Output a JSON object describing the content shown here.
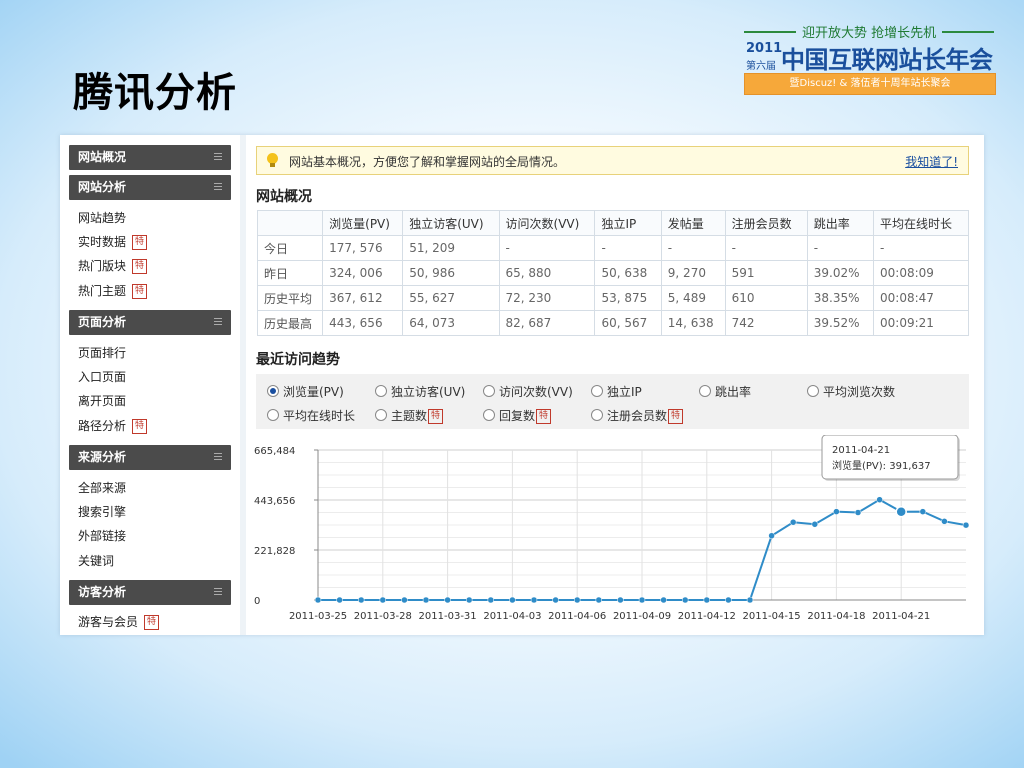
{
  "slide": {
    "title": "腾讯分析"
  },
  "logo": {
    "tagline": "迎开放大势 抢增长先机",
    "year": "2011",
    "edition": "第六届",
    "name": "中国互联网站长年会",
    "subtitle": "暨Discuz! & 落伍者十周年站长聚会",
    "colors": {
      "green": "#2c8a3e",
      "blue": "#1a4f9c",
      "orange": "#f6a83a"
    }
  },
  "sidebar": {
    "sections": [
      {
        "title": "网站概况",
        "items": []
      },
      {
        "title": "网站分析",
        "items": [
          {
            "label": "网站趋势",
            "badge": ""
          },
          {
            "label": "实时数据",
            "badge": "特"
          },
          {
            "label": "热门版块",
            "badge": "特"
          },
          {
            "label": "热门主题",
            "badge": "特"
          }
        ]
      },
      {
        "title": "页面分析",
        "items": [
          {
            "label": "页面排行",
            "badge": ""
          },
          {
            "label": "入口页面",
            "badge": ""
          },
          {
            "label": "离开页面",
            "badge": ""
          },
          {
            "label": "路径分析",
            "badge": "特"
          }
        ]
      },
      {
        "title": "来源分析",
        "items": [
          {
            "label": "全部来源",
            "badge": ""
          },
          {
            "label": "搜索引擎",
            "badge": ""
          },
          {
            "label": "外部链接",
            "badge": ""
          },
          {
            "label": "关键词",
            "badge": ""
          }
        ]
      },
      {
        "title": "访客分析",
        "items": [
          {
            "label": "游客与会员",
            "badge": "特"
          }
        ]
      }
    ]
  },
  "notice": {
    "icon": "lightbulb-icon",
    "text": "网站基本概况，方便您了解和掌握网站的全局情况。",
    "link": "我知道了!"
  },
  "overview": {
    "title": "网站概况",
    "headers": [
      "",
      "浏览量(PV)",
      "独立访客(UV)",
      "访问次数(VV)",
      "独立IP",
      "发帖量",
      "注册会员数",
      "跳出率",
      "平均在线时长"
    ],
    "rows": [
      [
        "今日",
        "177, 576",
        "51, 209",
        "-",
        "-",
        "-",
        "-",
        "-",
        "-"
      ],
      [
        "昨日",
        "324, 006",
        "50, 986",
        "65, 880",
        "50, 638",
        "9, 270",
        "591",
        "39.02%",
        "00:08:09"
      ],
      [
        "历史平均",
        "367, 612",
        "55, 627",
        "72, 230",
        "53, 875",
        "5, 489",
        "610",
        "38.35%",
        "00:08:47"
      ],
      [
        "历史最高",
        "443, 656",
        "64, 073",
        "82, 687",
        "60, 567",
        "14, 638",
        "742",
        "39.52%",
        "00:09:21"
      ]
    ]
  },
  "trend": {
    "title": "最近访问趋势",
    "options": [
      {
        "label": "浏览量(PV)",
        "selected": true,
        "badge": ""
      },
      {
        "label": "独立访客(UV)",
        "selected": false,
        "badge": ""
      },
      {
        "label": "访问次数(VV)",
        "selected": false,
        "badge": ""
      },
      {
        "label": "独立IP",
        "selected": false,
        "badge": ""
      },
      {
        "label": "跳出率",
        "selected": false,
        "badge": ""
      },
      {
        "label": "平均浏览次数",
        "selected": false,
        "badge": ""
      },
      {
        "label": "平均在线时长",
        "selected": false,
        "badge": ""
      },
      {
        "label": "主题数",
        "selected": false,
        "badge": "特"
      },
      {
        "label": "回复数",
        "selected": false,
        "badge": "特"
      },
      {
        "label": "注册会员数",
        "selected": false,
        "badge": "特"
      }
    ]
  },
  "chart_data": {
    "type": "line",
    "ylabel": "",
    "xlabel": "",
    "ylim": [
      0,
      665484
    ],
    "yticks": [
      "0",
      "221,828",
      "443,656",
      "665,484"
    ],
    "xticks": [
      "2011-03-25",
      "2011-03-28",
      "2011-03-31",
      "2011-04-03",
      "2011-04-06",
      "2011-04-09",
      "2011-04-12",
      "2011-04-15",
      "2011-04-18",
      "2011-04-21"
    ],
    "x": [
      "2011-03-25",
      "2011-03-26",
      "2011-03-27",
      "2011-03-28",
      "2011-03-29",
      "2011-03-30",
      "2011-03-31",
      "2011-04-01",
      "2011-04-02",
      "2011-04-03",
      "2011-04-04",
      "2011-04-05",
      "2011-04-06",
      "2011-04-07",
      "2011-04-08",
      "2011-04-09",
      "2011-04-10",
      "2011-04-11",
      "2011-04-12",
      "2011-04-13",
      "2011-04-14",
      "2011-04-15",
      "2011-04-16",
      "2011-04-17",
      "2011-04-18",
      "2011-04-19",
      "2011-04-20",
      "2011-04-21",
      "2011-04-22",
      "2011-04-23",
      "2011-04-24"
    ],
    "series": [
      {
        "name": "浏览量(PV)",
        "color": "#2f8cc8",
        "values": [
          0,
          0,
          0,
          0,
          0,
          0,
          0,
          0,
          0,
          0,
          0,
          0,
          0,
          0,
          0,
          0,
          0,
          0,
          0,
          0,
          0,
          285000,
          345000,
          336000,
          392000,
          388000,
          445000,
          391637,
          392000,
          349000,
          332000
        ]
      }
    ],
    "tooltip": {
      "date": "2011-04-21",
      "label": "浏览量(PV): 391,637"
    },
    "grid": true,
    "highlight_index": 27
  }
}
